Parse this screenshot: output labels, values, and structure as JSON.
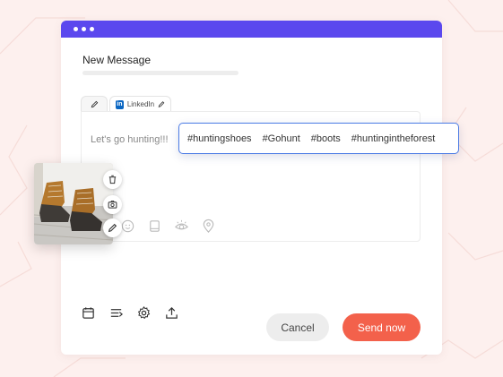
{
  "window": {
    "title": "New Message",
    "titlebar_color": "#5b48ee"
  },
  "tabs": [
    {
      "icon": "pencil-icon",
      "label": ""
    },
    {
      "icon": "linkedin-icon",
      "label": "LinkedIn",
      "badge_text": "in"
    }
  ],
  "editor": {
    "message": "Let's go hunting!!!",
    "hashtags": [
      "#huntingshoes",
      "#Gohunt",
      "#boots",
      "#huntingintheforest"
    ],
    "toolbar_icons": [
      "emoji-icon",
      "book-icon",
      "eye-icon",
      "location-pin-icon"
    ]
  },
  "image_actions": [
    "trash-icon",
    "camera-icon",
    "pencil-icon"
  ],
  "bottom_toolbar": [
    "calendar-icon",
    "queue-icon",
    "gear-icon",
    "upload-icon"
  ],
  "buttons": {
    "cancel_label": "Cancel",
    "send_label": "Send now",
    "send_color": "#f3614b"
  }
}
